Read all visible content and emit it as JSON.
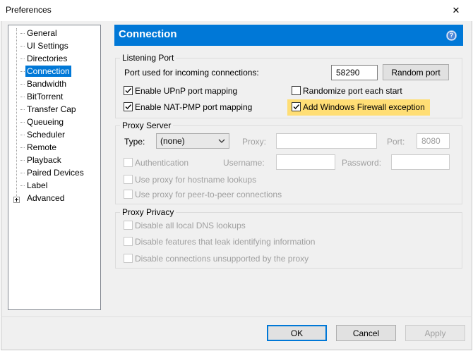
{
  "window": {
    "title": "Preferences",
    "close_glyph": "✕"
  },
  "tree": {
    "items": [
      {
        "label": "General",
        "selected": false
      },
      {
        "label": "UI Settings",
        "selected": false
      },
      {
        "label": "Directories",
        "selected": false
      },
      {
        "label": "Connection",
        "selected": true
      },
      {
        "label": "Bandwidth",
        "selected": false
      },
      {
        "label": "BitTorrent",
        "selected": false
      },
      {
        "label": "Transfer Cap",
        "selected": false
      },
      {
        "label": "Queueing",
        "selected": false
      },
      {
        "label": "Scheduler",
        "selected": false
      },
      {
        "label": "Remote",
        "selected": false
      },
      {
        "label": "Playback",
        "selected": false
      },
      {
        "label": "Paired Devices",
        "selected": false
      },
      {
        "label": "Label",
        "selected": false
      },
      {
        "label": "Advanced",
        "selected": false,
        "expandable": true
      }
    ]
  },
  "header": {
    "title": "Connection",
    "help_glyph": "?"
  },
  "listening_port": {
    "title": "Listening Port",
    "port_label": "Port used for incoming connections:",
    "port_value": "58290",
    "random_port_button": "Random port",
    "upnp": {
      "label": "Enable UPnP port mapping",
      "checked": true
    },
    "randomize": {
      "label": "Randomize port each start",
      "checked": false
    },
    "natpmp": {
      "label": "Enable NAT-PMP port mapping",
      "checked": true
    },
    "firewall": {
      "label": "Add Windows Firewall exception",
      "checked": true
    }
  },
  "proxy_server": {
    "title": "Proxy Server",
    "type_label": "Type:",
    "type_value": "(none)",
    "proxy_label": "Proxy:",
    "proxy_value": "",
    "port_label": "Port:",
    "port_value": "8080",
    "authentication": {
      "label": "Authentication",
      "checked": false
    },
    "username_label": "Username:",
    "username_value": "",
    "password_label": "Password:",
    "password_value": "",
    "hostname_lookups": {
      "label": "Use proxy for hostname lookups",
      "checked": false
    },
    "p2p": {
      "label": "Use proxy for peer-to-peer connections",
      "checked": false
    }
  },
  "proxy_privacy": {
    "title": "Proxy Privacy",
    "dns": {
      "label": "Disable all local DNS lookups",
      "checked": false
    },
    "leak": {
      "label": "Disable features that leak identifying information",
      "checked": false
    },
    "unsupported": {
      "label": "Disable connections unsupported by the proxy",
      "checked": false
    }
  },
  "footer": {
    "ok": "OK",
    "cancel": "Cancel",
    "apply": "Apply"
  },
  "colors": {
    "accent": "#0078d7",
    "highlight": "#ffde75",
    "dialog_bg": "#f0f0f0"
  }
}
